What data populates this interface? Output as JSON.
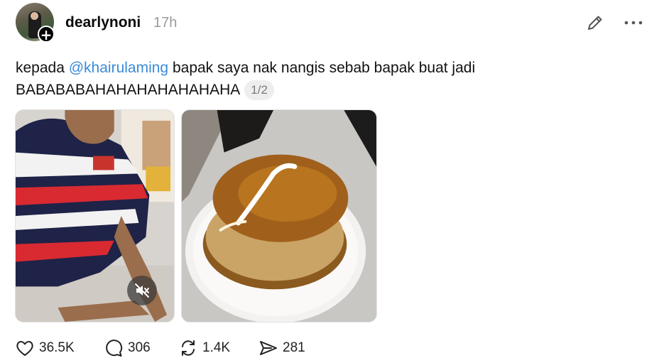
{
  "post": {
    "username": "dearlynoni",
    "time": "17h",
    "text_before": "kepada ",
    "mention": "@khairulaming",
    "text_after": " bapak saya nak nangis sebab bapak buat jadi BABABABAHAHAHAHAHAHAHA",
    "page_indicator": "1/2"
  },
  "media": [
    {
      "kind": "video",
      "muted": true
    },
    {
      "kind": "image"
    }
  ],
  "actions": {
    "likes": "36.5K",
    "replies": "306",
    "reposts": "1.4K",
    "shares": "281"
  },
  "colors": {
    "mention": "#3a8bd8",
    "muted_text": "#9a9a9a"
  },
  "icons": [
    "plus-icon",
    "edit-icon",
    "more-icon",
    "mute-icon",
    "heart-icon",
    "comment-icon",
    "repost-icon",
    "send-icon"
  ]
}
